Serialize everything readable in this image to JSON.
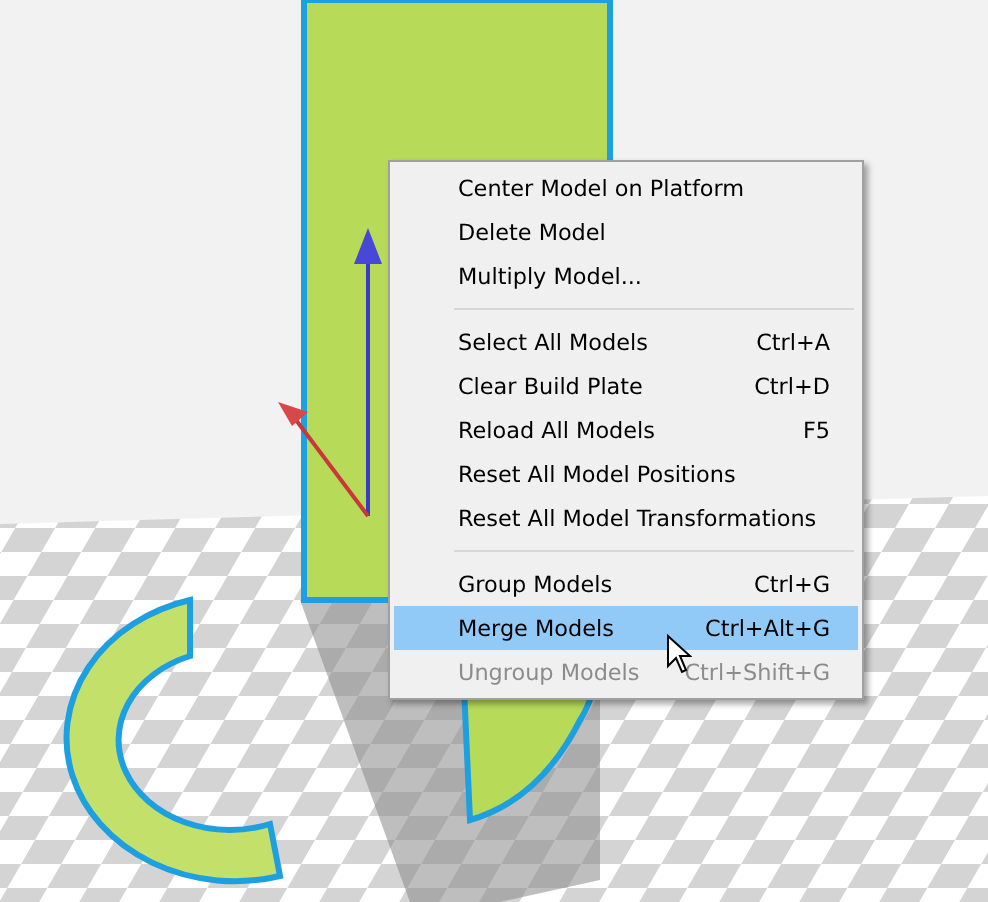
{
  "context_menu": {
    "sections": [
      {
        "items": [
          {
            "label": "Center Model on Platform",
            "selected": false,
            "disabled": false
          },
          {
            "label": "Delete Model",
            "selected": false,
            "disabled": false
          },
          {
            "label": "Multiply Model...",
            "selected": false,
            "disabled": false
          }
        ]
      },
      {
        "items": [
          {
            "label": "Select All Models",
            "shortcut": "Ctrl+A",
            "selected": false,
            "disabled": false
          },
          {
            "label": "Clear Build Plate",
            "shortcut": "Ctrl+D",
            "selected": false,
            "disabled": false
          },
          {
            "label": "Reload All Models",
            "shortcut": "F5",
            "selected": false,
            "disabled": false
          },
          {
            "label": "Reset All Model Positions",
            "selected": false,
            "disabled": false
          },
          {
            "label": "Reset All Model Transformations",
            "selected": false,
            "disabled": false
          }
        ]
      },
      {
        "items": [
          {
            "label": "Group Models",
            "shortcut": "Ctrl+G",
            "selected": false,
            "disabled": false
          },
          {
            "label": "Merge Models",
            "shortcut": "Ctrl+Alt+G",
            "selected": true,
            "disabled": false
          },
          {
            "label": "Ungroup Models",
            "shortcut": "Ctrl+Shift+G",
            "selected": false,
            "disabled": true
          }
        ]
      }
    ]
  }
}
